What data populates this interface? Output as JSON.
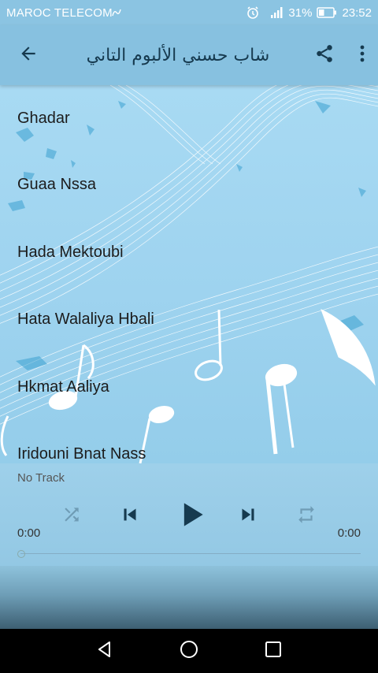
{
  "status_bar": {
    "carrier": "MAROC TELECOM",
    "battery_percent": "31%",
    "time": "23:52",
    "icons": [
      "carrier-signal-icon",
      "alarm-icon",
      "cell-signal-icon",
      "battery-icon"
    ]
  },
  "app_bar": {
    "title": "شاب حسني الألبوم التاني",
    "icons": [
      "back-arrow-icon",
      "share-icon",
      "more-vert-icon"
    ]
  },
  "tracks": [
    {
      "title": "Ghadar"
    },
    {
      "title": "Guaa Nssa"
    },
    {
      "title": "Hada Mektoubi"
    },
    {
      "title": "Hata Walaliya Hbali"
    },
    {
      "title": "Hkmat Aaliya"
    },
    {
      "title": "Iridouni Bnat Nass"
    }
  ],
  "player": {
    "now_playing": "No Track",
    "elapsed": "0:00",
    "duration": "0:00",
    "progress": 0,
    "icons": [
      "shuffle-icon",
      "previous-icon",
      "play-icon",
      "next-icon",
      "repeat-icon"
    ]
  },
  "nav_bar": {
    "icons": [
      "back-triangle-icon",
      "home-circle-icon",
      "recents-square-icon"
    ]
  },
  "colors": {
    "app_bar": "#87c1e0",
    "status_bar": "#8bc4e2",
    "content_bg": "#a8daf3",
    "text": "#1c1c1c",
    "nav_bar": "#000000"
  }
}
